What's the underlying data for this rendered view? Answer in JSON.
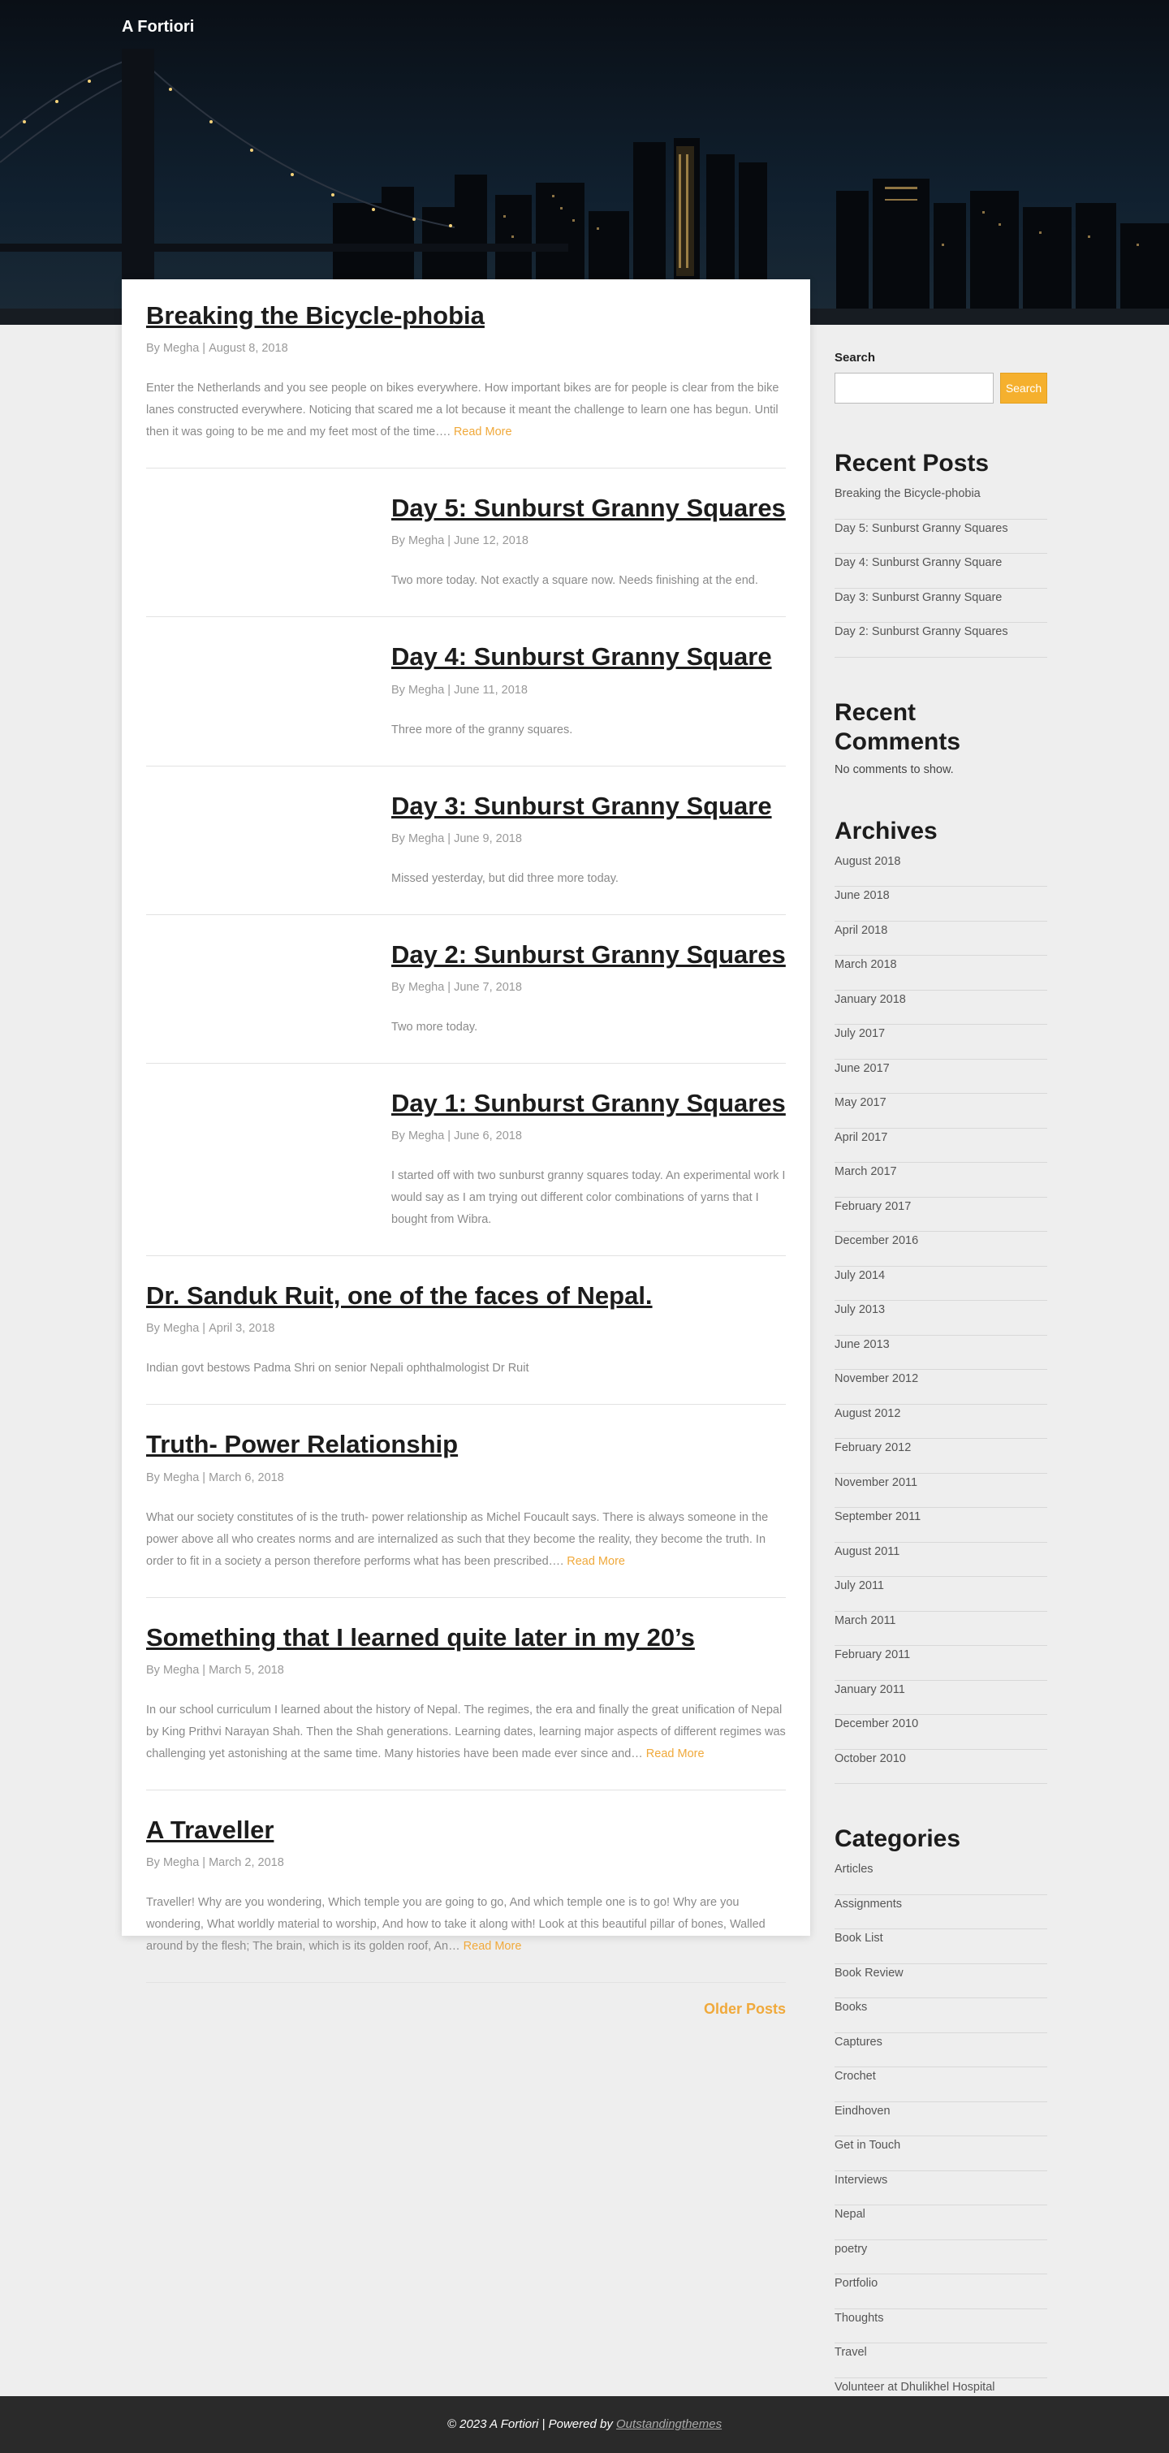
{
  "site": {
    "title": "A Fortiori"
  },
  "posts": [
    {
      "title": "Breaking the Bicycle-phobia",
      "author_prefix": "By",
      "author": "Megha",
      "date": "August 8, 2018",
      "excerpt": "Enter the Netherlands and you see people on bikes everywhere. How important bikes are for people is clear from the bike lanes constructed everywhere. Noticing that scared me a lot because it meant the challenge to learn one has begun. Until then it was going to be me and my feet most of the time…. ",
      "read_more": "Read More"
    },
    {
      "title": "Day 5: Sunburst Granny Squares",
      "author_prefix": "By",
      "author": "Megha",
      "date": "June 12, 2018",
      "excerpt": "Two more today. Not exactly a square now. Needs finishing at the end."
    },
    {
      "title": "Day 4: Sunburst Granny Square",
      "author_prefix": "By",
      "author": "Megha",
      "date": "June 11, 2018",
      "excerpt": "Three more of the granny squares."
    },
    {
      "title": "Day 3: Sunburst Granny Square",
      "author_prefix": "By",
      "author": "Megha",
      "date": "June 9, 2018",
      "excerpt": "Missed yesterday, but did three more today."
    },
    {
      "title": "Day 2: Sunburst Granny Squares",
      "author_prefix": "By",
      "author": "Megha",
      "date": "June 7, 2018",
      "excerpt": "Two more today."
    },
    {
      "title": "Day 1: Sunburst Granny Squares",
      "author_prefix": "By",
      "author": "Megha",
      "date": "June 6, 2018",
      "excerpt": "I started off with two sunburst granny squares today. An experimental work I would say as I am trying out different color combinations of yarns that I bought from Wibra."
    },
    {
      "title": "Dr. Sanduk Ruit, one of the faces of Nepal.",
      "author_prefix": "By",
      "author": "Megha",
      "date": "April 3, 2018",
      "excerpt": "Indian govt bestows Padma Shri on senior Nepali ophthalmologist Dr Ruit"
    },
    {
      "title": "Truth- Power Relationship",
      "author_prefix": "By",
      "author": "Megha",
      "date": "March 6, 2018",
      "excerpt": "What our society constitutes of is the truth- power relationship as Michel Foucault says. There is always someone in the power above all who creates norms and are internalized as such that they become the reality, they become the truth. In order to fit in a society a person therefore performs what has been prescribed…. ",
      "read_more": "Read More"
    },
    {
      "title": "Something that I learned quite later in my 20’s",
      "author_prefix": "By",
      "author": "Megha",
      "date": "March 5, 2018",
      "excerpt": "In our school curriculum I learned about the history of Nepal. The regimes, the era and finally the great unification of Nepal by King Prithvi Narayan Shah. Then the Shah generations. Learning dates, learning major aspects of different regimes was challenging yet astonishing at the same time. Many histories have been made ever since and… ",
      "read_more": "Read More"
    },
    {
      "title": "A Traveller",
      "author_prefix": "By",
      "author": "Megha",
      "date": "March 2, 2018",
      "excerpt": "Traveller! Why are you wondering, Which temple you are going to go, And which temple one is to go! Why are you wondering, What worldly material to worship, And how to take it along with! Look at this beautiful pillar of bones, Walled around by the flesh; The brain, which is its golden roof, An… ",
      "read_more": "Read More"
    }
  ],
  "pagination": {
    "older_label": "Older Posts"
  },
  "sidebar": {
    "search": {
      "label": "Search",
      "button": "Search",
      "value": ""
    },
    "recent_posts": {
      "title": "Recent Posts",
      "items": [
        "Breaking the Bicycle-phobia",
        "Day 5: Sunburst Granny Squares",
        "Day 4: Sunburst Granny Square",
        "Day 3: Sunburst Granny Square",
        "Day 2: Sunburst Granny Squares"
      ]
    },
    "recent_comments": {
      "title": "Recent Comments",
      "empty": "No comments to show."
    },
    "archives": {
      "title": "Archives",
      "items": [
        "August 2018",
        "June 2018",
        "April 2018",
        "March 2018",
        "January 2018",
        "July 2017",
        "June 2017",
        "May 2017",
        "April 2017",
        "March 2017",
        "February 2017",
        "December 2016",
        "July 2014",
        "July 2013",
        "June 2013",
        "November 2012",
        "August 2012",
        "February 2012",
        "November 2011",
        "September 2011",
        "August 2011",
        "July 2011",
        "March 2011",
        "February 2011",
        "January 2011",
        "December 2010",
        "October 2010"
      ]
    },
    "categories": {
      "title": "Categories",
      "items": [
        "Articles",
        "Assignments",
        "Book List",
        "Book Review",
        "Books",
        "Captures",
        "Crochet",
        "Eindhoven",
        "Get in Touch",
        "Interviews",
        "Nepal",
        "poetry",
        "Portfolio",
        "Thoughts",
        "Travel",
        "Volunteer at Dhulikhel Hospital"
      ]
    }
  },
  "footer": {
    "copyright": "© 2023 A Fortiori | Powered by ",
    "credit": "Outstandingthemes"
  },
  "colors": {
    "accent": "#f0a93b",
    "footer_bg": "#2a2a2a",
    "page_bg": "#eeeeee"
  }
}
